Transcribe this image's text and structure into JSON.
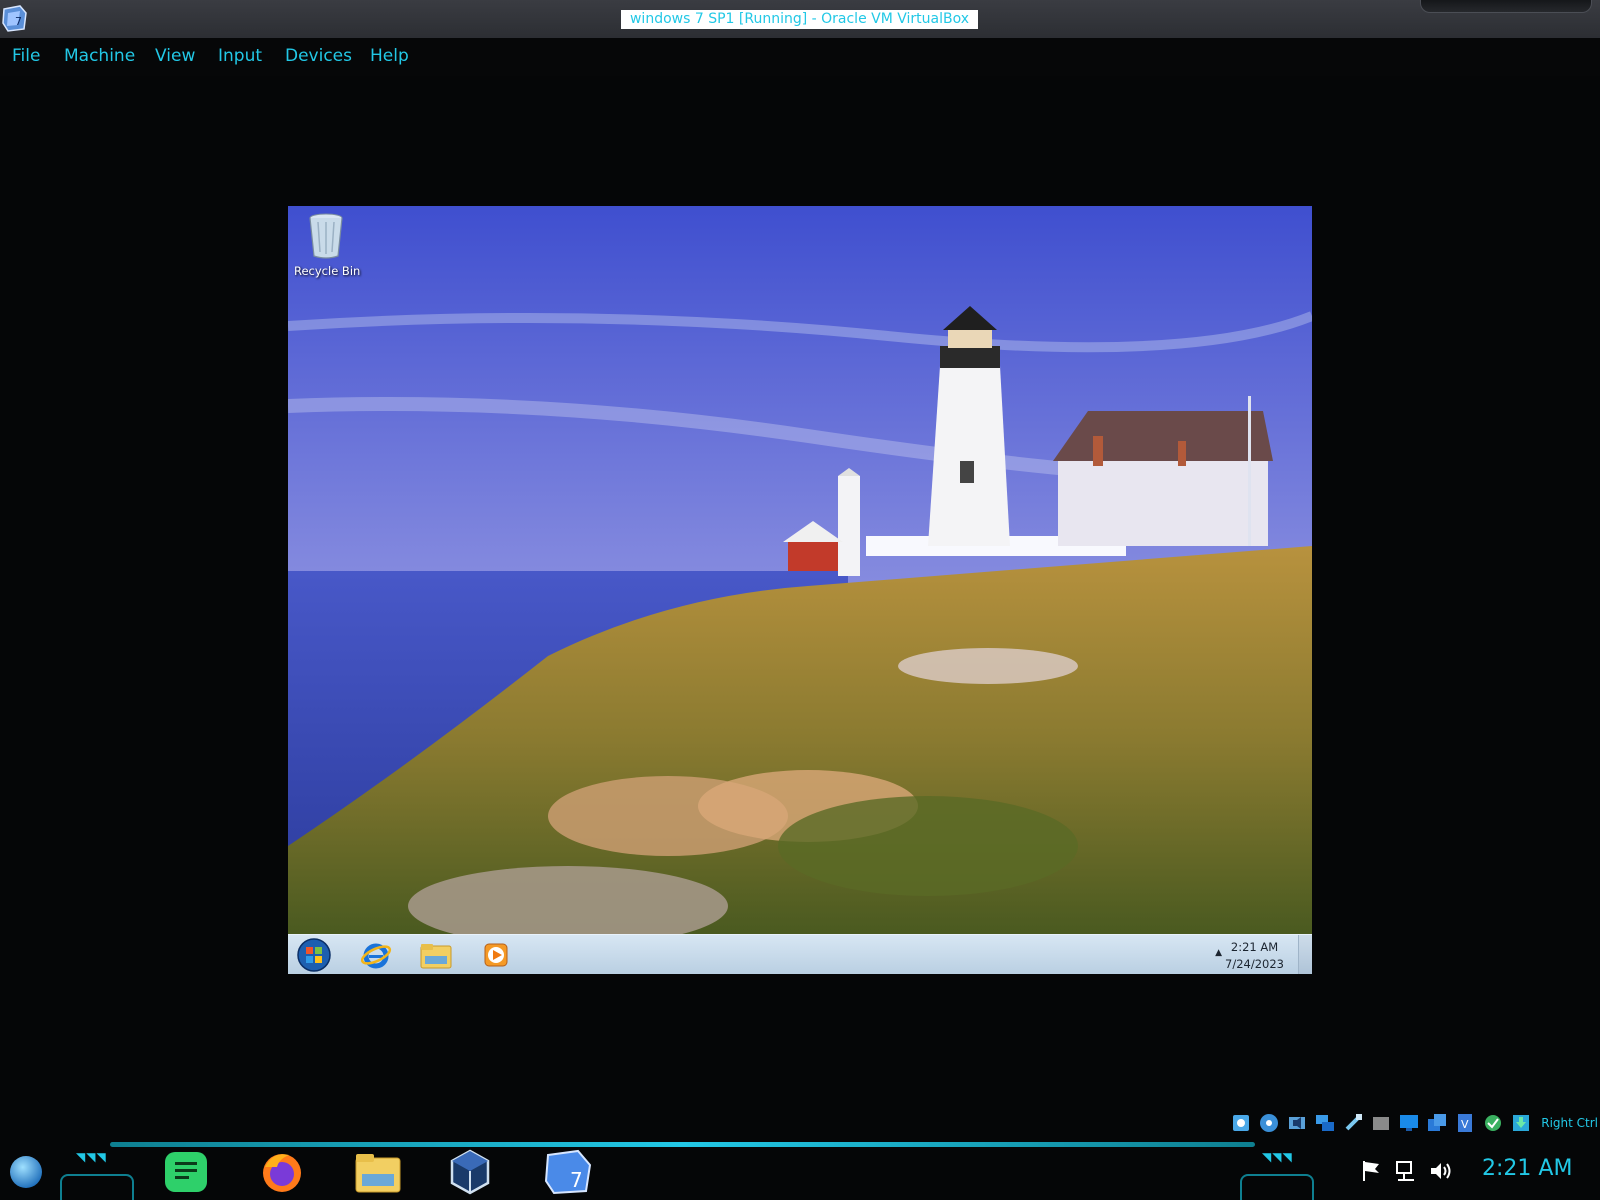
{
  "window": {
    "title": "windows 7 SP1 [Running] - Oracle VM VirtualBox",
    "app_icon": "virtualbox-win7-icon"
  },
  "menu": {
    "items": [
      {
        "label": "File"
      },
      {
        "label": "Machine"
      },
      {
        "label": "View"
      },
      {
        "label": "Input"
      },
      {
        "label": "Devices"
      },
      {
        "label": "Help"
      }
    ]
  },
  "guest": {
    "wallpaper": "lighthouse-coast-wallpaper",
    "desktop_icons": [
      {
        "label": "Recycle Bin",
        "icon": "recycle-bin-icon"
      }
    ],
    "taskbar": {
      "items": [
        {
          "name": "start-orb",
          "icon": "windows-orb-icon"
        },
        {
          "name": "internet-explorer",
          "icon": "internet-explorer-icon"
        },
        {
          "name": "windows-explorer",
          "icon": "folder-icon"
        },
        {
          "name": "media-player",
          "icon": "media-player-icon"
        }
      ],
      "clock": {
        "time": "2:21 AM",
        "date": "7/24/2023"
      }
    }
  },
  "status_bar": {
    "indicators": [
      "hard-disk-icon",
      "optical-drive-icon",
      "audio-icon",
      "network-icon",
      "usb-icon",
      "shared-folders-icon",
      "display-icon",
      "video-capture-icon",
      "vt-x-icon",
      "guest-additions-icon",
      "mouse-integration-icon"
    ],
    "host_key": "Right Ctrl"
  },
  "host_taskbar": {
    "apps": [
      "start-orb-icon",
      "notes-icon",
      "firefox-icon",
      "file-manager-icon",
      "virtualbox-icon",
      "windows7-vm-icon"
    ],
    "tray": [
      "flag-icon",
      "network-icon",
      "volume-icon"
    ],
    "clock": "2:21 AM",
    "accent": "#22c8e6"
  }
}
